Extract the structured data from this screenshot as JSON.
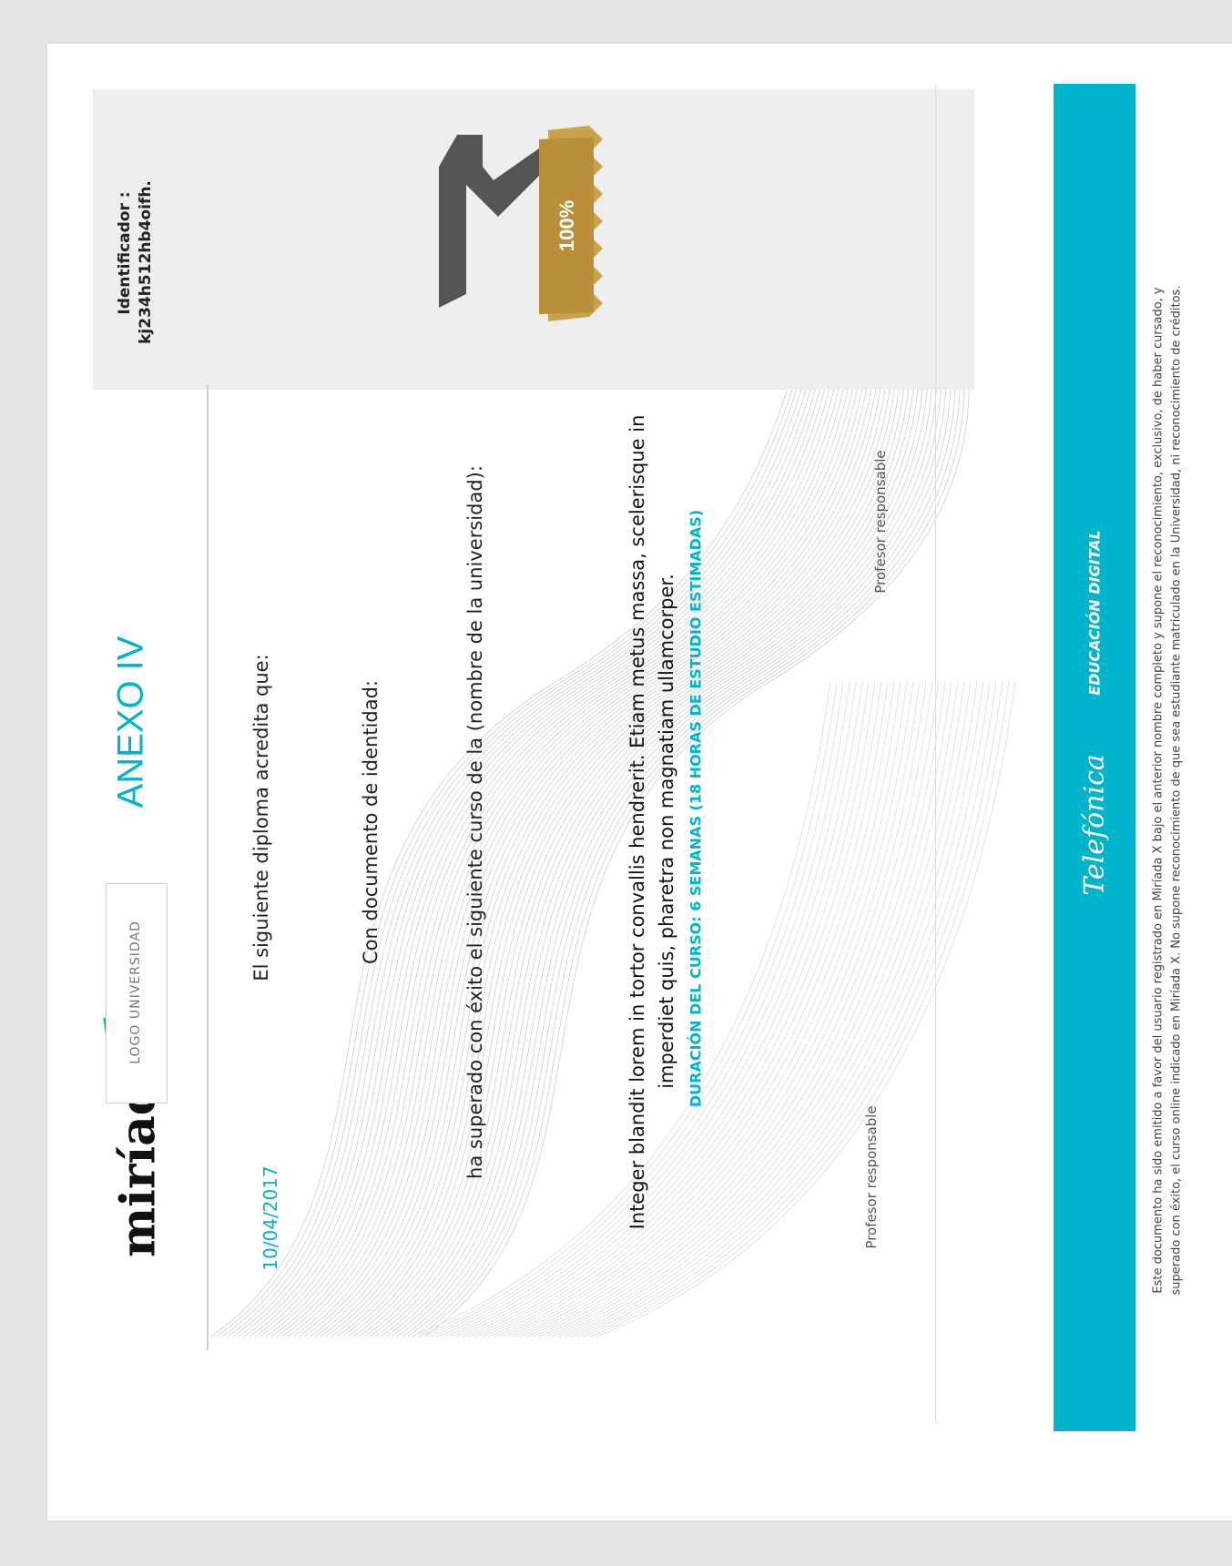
{
  "brand": {
    "name": "miríada",
    "mark_letter": "x"
  },
  "logo_placeholder": "LOGO UNIVERSIDAD",
  "title": "ANEXO IV",
  "date": "10/04/2017",
  "identifier": {
    "label": "Identificador :",
    "value": "kj234h512hb4oifh."
  },
  "badge": {
    "percent": "100%"
  },
  "body": {
    "line1": "El siguiente diploma acredita que:",
    "line2": "Con documento de identidad:",
    "line3": "ha superado con éxito el siguiente curso de la (nombre de la universidad):",
    "course_lines": [
      "Integer blandit lorem in tortor convallis hendrerit. Etiam metus massa, scelerisque in",
      "imperdiet quis, pharetra non magnatiam ullamcorper."
    ],
    "duration": "DURACIÓN DEL CURSO: 6 SEMANAS (18 HORAS DE ESTUDIO ESTIMADAS)"
  },
  "signatures": {
    "left": "Profesor responsable",
    "right": "Profesor responsable"
  },
  "footer_band": {
    "sponsor": "Telefónica",
    "label": "EDUCACIÓN DIGITAL"
  },
  "disclaimer": [
    "Este documento ha sido emitido a favor del usuario registrado en Miríada X bajo el anterior nombre completo y supone el reconocimiento, exclusivo, de haber cursado, y",
    "superado con éxito, el curso online indicado en Miríada X. No supone reconocimiento de que sea estudiante matriculado en la Universidad, ni reconocimiento de créditos."
  ],
  "colors": {
    "accent": "#00b4cc",
    "gold": "#c9a24a",
    "badge_gray": "#555555",
    "text": "#222222"
  }
}
